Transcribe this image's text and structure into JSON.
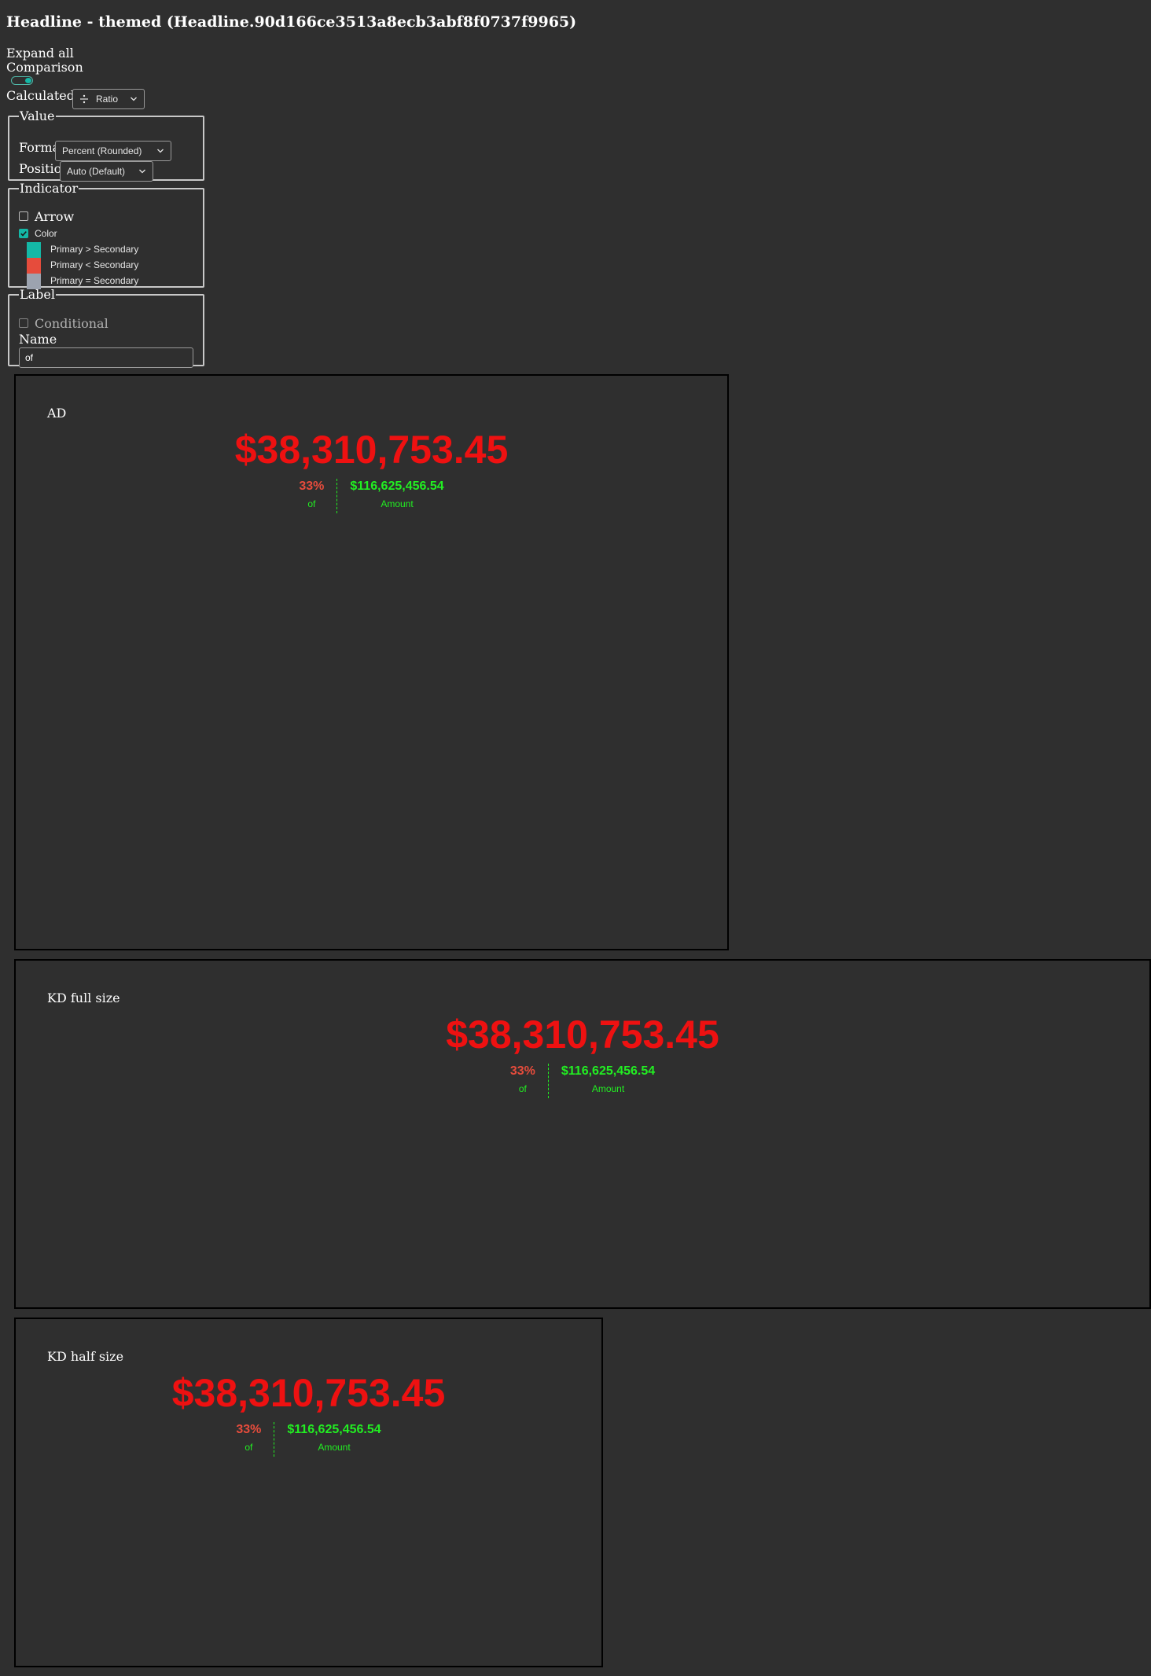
{
  "title": "Headline - themed (Headline.90d166ce3513a8ecb3abf8f0737f9965)",
  "controls": {
    "expand_all": "Expand all",
    "comparison": "Comparison",
    "comparison_enabled": true,
    "calculated_as_label": "Calculated as",
    "calculated_as_value": "Ratio",
    "value_legend": "Value",
    "format_label": "Format",
    "format_value": "Percent (Rounded)",
    "position_label": "Position",
    "position_value": "Auto (Default)",
    "indicator_legend": "Indicator",
    "arrow_label": "Arrow",
    "arrow_checked": false,
    "color_label": "Color",
    "color_checked": true,
    "colors": [
      {
        "label": "Primary > Secondary",
        "color": "#14b8a6"
      },
      {
        "label": "Primary < Secondary",
        "color": "#e64c3c"
      },
      {
        "label": "Primary = Secondary",
        "color": "#9ca3af"
      }
    ],
    "label_legend": "Label",
    "conditional_label": "Conditional",
    "conditional_checked": false,
    "name_label": "Name",
    "name_value": "of"
  },
  "panels": [
    {
      "label": "AD",
      "primary": "$38,310,753.45",
      "ratio": "33%",
      "ratio_label": "of",
      "secondary": "$116,625,456.54",
      "secondary_label": "Amount"
    },
    {
      "label": "KD full size",
      "primary": "$38,310,753.45",
      "ratio": "33%",
      "ratio_label": "of",
      "secondary": "$116,625,456.54",
      "secondary_label": "Amount"
    },
    {
      "label": "KD half size",
      "primary": "$38,310,753.45",
      "ratio": "33%",
      "ratio_label": "of",
      "secondary": "$116,625,456.54",
      "secondary_label": "Amount"
    }
  ],
  "theme": {
    "background": "#2f2f2f",
    "headline_color": "#ee1111",
    "ratio_color": "#e64c3c",
    "secondary_color": "#22ee22",
    "accent": "#14b8a6"
  }
}
